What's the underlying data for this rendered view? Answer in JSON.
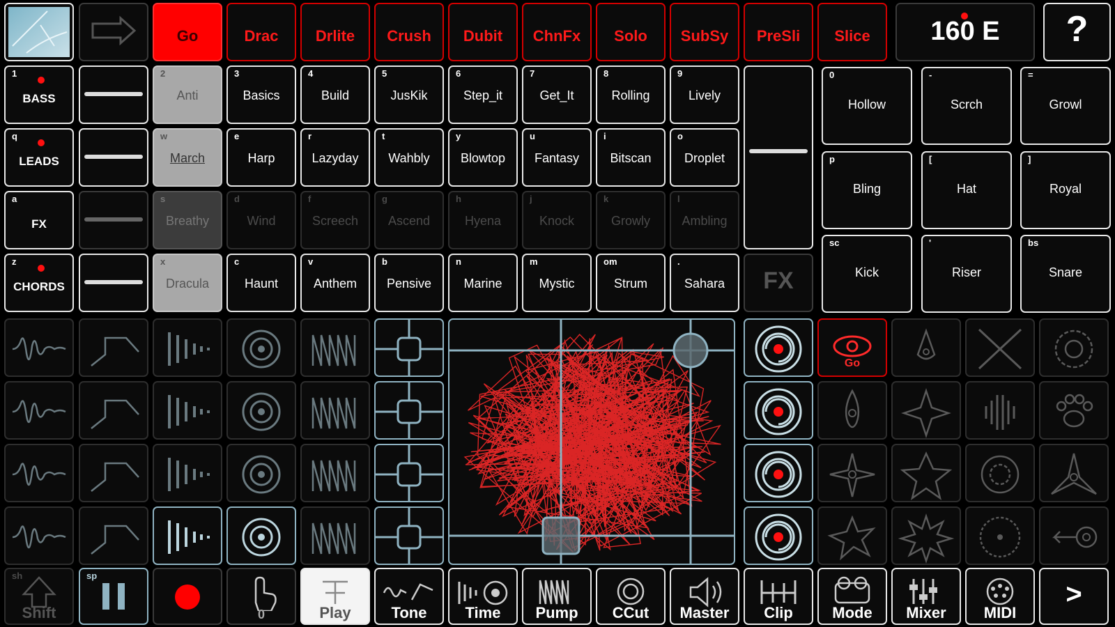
{
  "top_bar": {
    "preset_label": "Go",
    "preset_labels": [
      "Drac",
      "Drlite",
      "Crush",
      "Dubit",
      "ChnFx",
      "Solo",
      "SubSy",
      "PreSli",
      "Slice"
    ],
    "tempo": "160 E",
    "help": "?"
  },
  "tracks": [
    {
      "key": "1",
      "name": "BASS"
    },
    {
      "key": "q",
      "name": "LEADS"
    },
    {
      "key": "a",
      "name": "FX"
    },
    {
      "key": "z",
      "name": "CHORDS"
    }
  ],
  "patterns": [
    [
      {
        "k": "2",
        "n": "Anti"
      },
      {
        "k": "3",
        "n": "Basics"
      },
      {
        "k": "4",
        "n": "Build"
      },
      {
        "k": "5",
        "n": "JusKik"
      },
      {
        "k": "6",
        "n": "Step_it"
      },
      {
        "k": "7",
        "n": "Get_It"
      },
      {
        "k": "8",
        "n": "Rolling"
      },
      {
        "k": "9",
        "n": "Lively"
      }
    ],
    [
      {
        "k": "w",
        "n": "March"
      },
      {
        "k": "e",
        "n": "Harp"
      },
      {
        "k": "r",
        "n": "Lazyday"
      },
      {
        "k": "t",
        "n": "Wahbly"
      },
      {
        "k": "y",
        "n": "Blowtop"
      },
      {
        "k": "u",
        "n": "Fantasy"
      },
      {
        "k": "i",
        "n": "Bitscan"
      },
      {
        "k": "o",
        "n": "Droplet"
      }
    ],
    [
      {
        "k": "s",
        "n": "Breathy"
      },
      {
        "k": "d",
        "n": "Wind"
      },
      {
        "k": "f",
        "n": "Screech"
      },
      {
        "k": "g",
        "n": "Ascend"
      },
      {
        "k": "h",
        "n": "Hyena"
      },
      {
        "k": "j",
        "n": "Knock"
      },
      {
        "k": "k",
        "n": "Growly"
      },
      {
        "k": "l",
        "n": "Ambling"
      }
    ],
    [
      {
        "k": "x",
        "n": "Dracula"
      },
      {
        "k": "c",
        "n": "Haunt"
      },
      {
        "k": "v",
        "n": "Anthem"
      },
      {
        "k": "b",
        "n": "Pensive"
      },
      {
        "k": "n",
        "n": "Marine"
      },
      {
        "k": "m",
        "n": "Mystic"
      },
      {
        "k": "om",
        "n": "Strum"
      },
      {
        "k": ".",
        "n": "Sahara"
      }
    ]
  ],
  "fx_label": "FX",
  "one_shots": [
    {
      "k": "0",
      "n": "Hollow"
    },
    {
      "k": "-",
      "n": "Scrch"
    },
    {
      "k": "=",
      "n": "Growl"
    },
    {
      "k": "p",
      "n": "Bling"
    },
    {
      "k": "[",
      "n": "Hat"
    },
    {
      "k": "]",
      "n": "Royal"
    },
    {
      "k": "sc",
      "n": "Kick"
    },
    {
      "k": "'",
      "n": "Riser"
    },
    {
      "k": "bs",
      "n": "Snare"
    }
  ],
  "go_fx_label": "Go",
  "bottom": {
    "shift_key": "sh",
    "shift": "Shift",
    "pause_key": "sp",
    "touch_count": "0",
    "play": "Play",
    "tone": "Tone",
    "time": "Time",
    "pump": "Pump",
    "ccut": "CCut",
    "master": "Master",
    "clip": "Clip",
    "mode": "Mode",
    "mixer": "Mixer",
    "midi": "MIDI",
    "next": ">"
  },
  "colors": {
    "accent": "#ff0000",
    "blue": "#8fb3c2",
    "gray": "#a8a8a8"
  }
}
